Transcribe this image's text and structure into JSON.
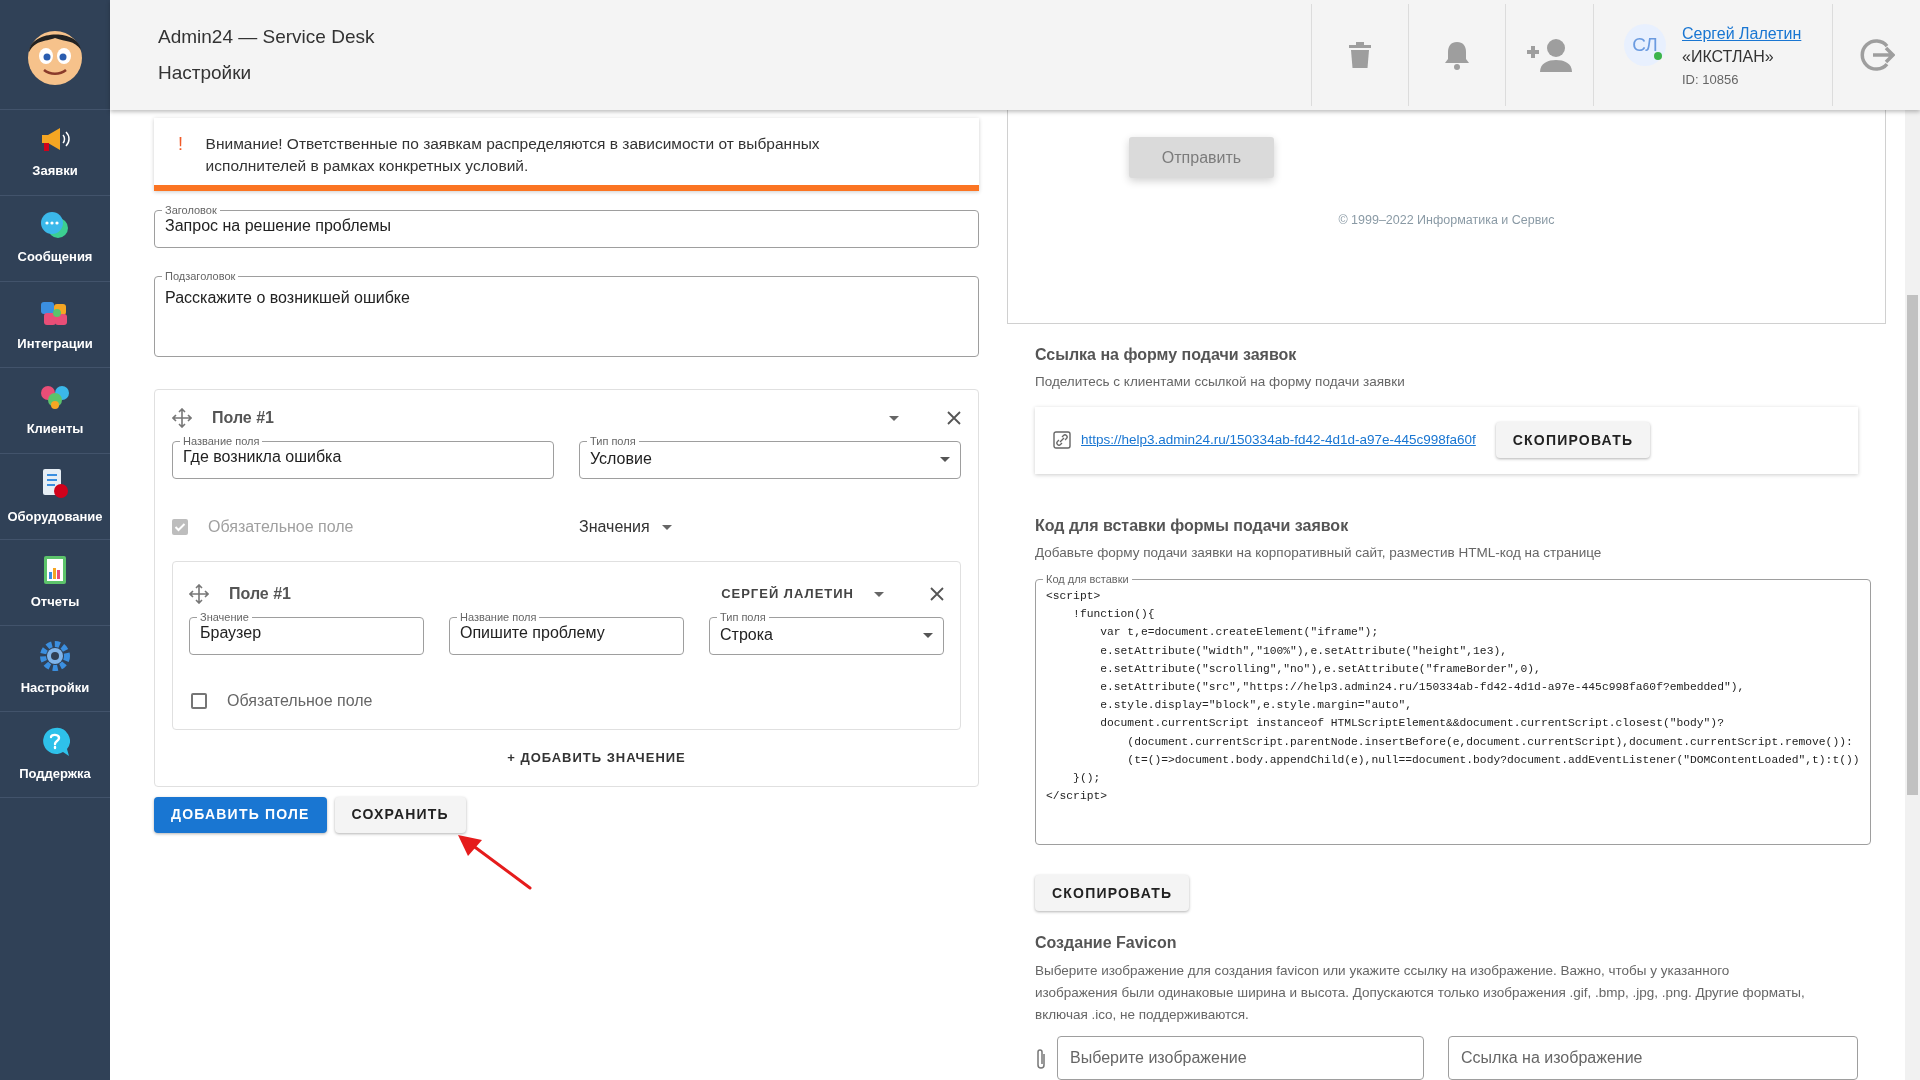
{
  "header": {
    "app_title": "Admin24 — Service Desk",
    "page_title": "Настройки",
    "user": {
      "initials": "СЛ",
      "online": true,
      "name": "Сергей Лалетин",
      "company": "«ИКСТЛАН»",
      "id": "ID: 10856"
    }
  },
  "sidebar": {
    "items": [
      {
        "label": "Заявки"
      },
      {
        "label": "Сообщения"
      },
      {
        "label": "Интеграции"
      },
      {
        "label": "Клиенты"
      },
      {
        "label": "Оборудование"
      },
      {
        "label": "Отчеты"
      },
      {
        "label": "Настройки"
      },
      {
        "label": "Поддержка"
      }
    ]
  },
  "alert": {
    "mark": "!",
    "text": "Внимание! Ответственные по заявкам распределяются в зависимости от выбранных исполнителей в рамках конкретных условий."
  },
  "form": {
    "title_field": {
      "label": "Заголовок",
      "value": "Запрос на решение проблемы"
    },
    "subtitle_field": {
      "label": "Подзаголовок",
      "value": "Расскажите о возникшей ошибке"
    },
    "fields": [
      {
        "title": "Поле #1",
        "name_field": {
          "label": "Название поля",
          "value": "Где возникла ошибка"
        },
        "type_field": {
          "label": "Тип поля",
          "value": "Условие"
        },
        "required": {
          "label": "Обязательное поле",
          "checked": true,
          "disabled": true
        },
        "values_toggle": "Значения",
        "values": [
          {
            "title": "Поле #1",
            "assignee": "СЕРГЕЙ ЛАЛЕТИН",
            "value_field": {
              "label": "Значение",
              "value": "Браузер"
            },
            "name_field": {
              "label": "Название поля",
              "value": "Опишите проблему"
            },
            "type_field": {
              "label": "Тип поля",
              "value": "Строка"
            },
            "required": {
              "label": "Обязательное поле",
              "checked": false,
              "disabled": false
            }
          }
        ],
        "add_value": "+ ДОБАВИТЬ ЗНАЧЕНИЕ"
      }
    ],
    "buttons": [
      {
        "label": "ДОБАВИТЬ ПОЛЕ",
        "kind": "primary"
      },
      {
        "label": "СОХРАНИТЬ",
        "kind": "secondary"
      }
    ]
  },
  "preview": {
    "submit_button": {
      "label": "Отправить",
      "disabled": true
    },
    "copyright": "© 1999–2022 Информатика и Сервис"
  },
  "share_link": {
    "heading": "Ссылка на форму подачи заявок",
    "subtitle": "Поделитесь с клиентами ссылкой на форму подачи заявки",
    "url": "https://help3.admin24.ru/150334ab-fd42-4d1d-a97e-445c998fa60f",
    "copy_button": "СКОПИРОВАТЬ"
  },
  "embed_code": {
    "heading": "Код для вставки формы подачи заявок",
    "subtitle": "Добавьте форму подачи заявки на корпоративный сайт, разместив HTML-код на странице",
    "field_label": "Код для вставки",
    "lines": [
      "<script>",
      "    !function(){",
      "        var t,e=document.createElement(\"iframe\");",
      "        e.setAttribute(\"width\",\"100%\"),e.setAttribute(\"height\",1e3),",
      "        e.setAttribute(\"scrolling\",\"no\"),e.setAttribute(\"frameBorder\",0),",
      "        e.setAttribute(\"src\",\"https://help3.admin24.ru/150334ab-fd42-4d1d-a97e-445c998fa60f?embedded\"),",
      "        e.style.display=\"block\",e.style.margin=\"auto\",",
      "        document.currentScript instanceof HTMLScriptElement&&document.currentScript.closest(\"body\")?",
      "            (document.currentScript.parentNode.insertBefore(e,document.currentScript),document.currentScript.remove()):",
      "            (t=()=>document.body.appendChild(e),null==document.body?document.addEventListener(\"DOMContentLoaded\",t):t())",
      "    }();",
      "</script>"
    ],
    "copy_button": "СКОПИРОВАТЬ"
  },
  "favicon": {
    "heading": "Создание Favicon",
    "description": "Выберите изображение для создания favicon или укажите ссылку на изображение. Важно, чтобы у указанного изображения были одинаковые ширина и высота. Допускаются только изображения .gif, .bmp, .jpg, .png. Другие форматы, включая .ico, не поддерживаются.",
    "file_placeholder": "Выберите изображение",
    "url_placeholder": "Ссылка на изображение"
  }
}
